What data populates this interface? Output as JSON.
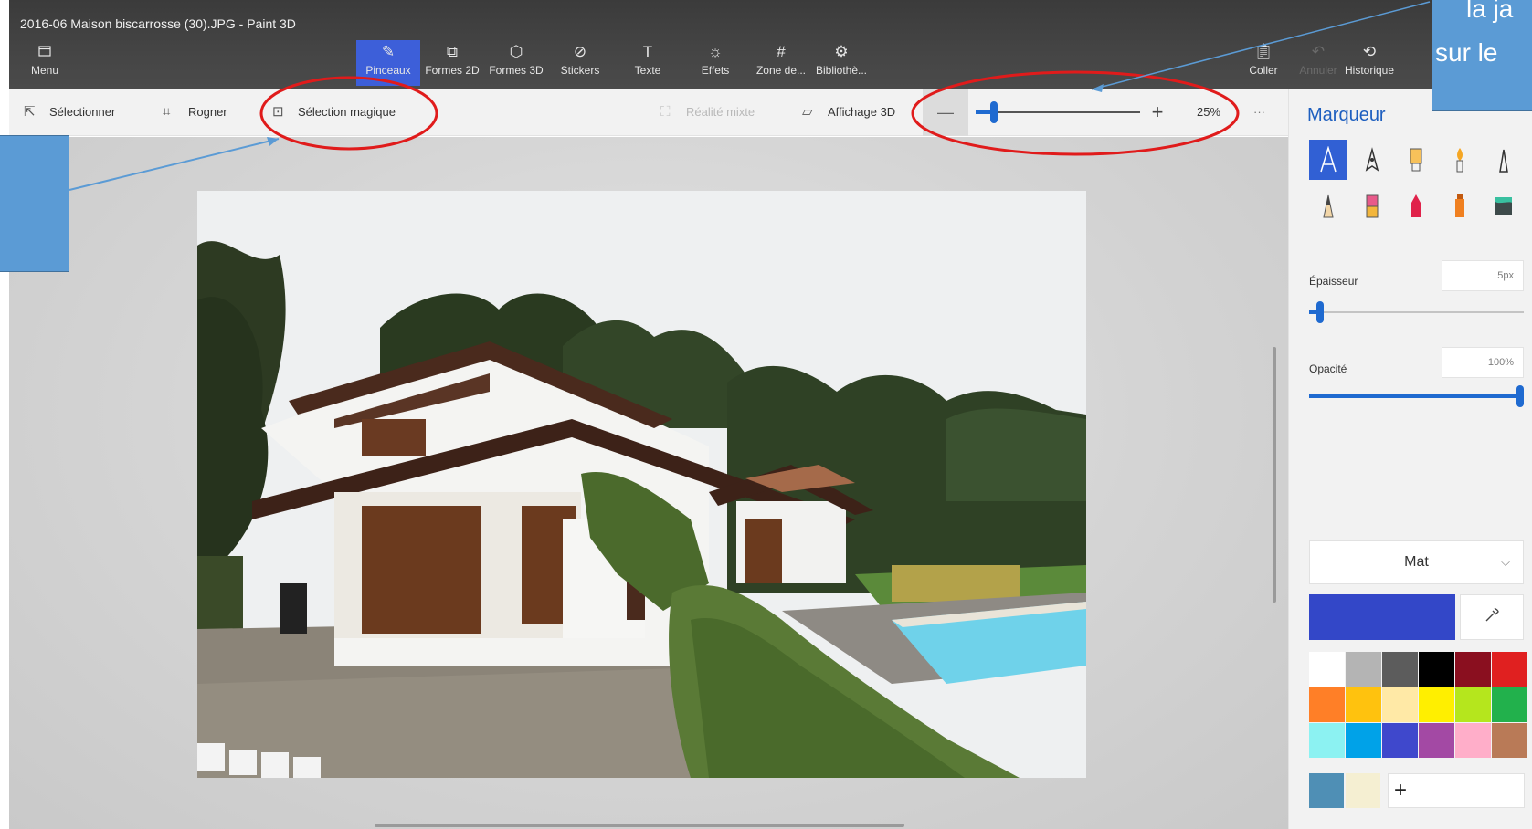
{
  "window": {
    "title": "2016-06 Maison biscarrosse (30).JPG - Paint 3D"
  },
  "menu": {
    "label": "Menu",
    "icon": "folder-icon"
  },
  "toolbar": {
    "tools": [
      {
        "label": "Pinceaux",
        "icon": "brush-icon",
        "active": true
      },
      {
        "label": "Formes 2D",
        "icon": "shapes-2d-icon"
      },
      {
        "label": "Formes 3D",
        "icon": "shapes-3d-icon"
      },
      {
        "label": "Stickers",
        "icon": "sticker-icon"
      },
      {
        "label": "Texte",
        "icon": "text-icon"
      },
      {
        "label": "Effets",
        "icon": "effects-icon"
      },
      {
        "label": "Zone de...",
        "icon": "canvas-icon"
      },
      {
        "label": "Bibliothè...",
        "icon": "library-icon"
      }
    ],
    "right": [
      {
        "label": "Coller",
        "icon": "paste-icon"
      },
      {
        "label": "Annuler",
        "icon": "undo-icon",
        "disabled": true
      },
      {
        "label": "Historique",
        "icon": "history-icon"
      }
    ]
  },
  "toolbar2": {
    "select": "Sélectionner",
    "crop": "Rogner",
    "magic_select": "Sélection magique",
    "mixed_reality": "Réalité mixte",
    "view3d": "Affichage 3D",
    "zoom_out": "—",
    "zoom_in": "+",
    "zoom_value": "25%",
    "zoom_fraction": 0.1,
    "more": "···"
  },
  "panel": {
    "title": "Marqueur",
    "thickness_label": "Épaisseur",
    "thickness_value": "5px",
    "thickness_fraction": 0.05,
    "opacity_label": "Opacité",
    "opacity_value": "100%",
    "opacity_fraction": 1.0,
    "finish": "Mat",
    "finish_chevron": "⌵",
    "eyedropper_icon": "eyedropper-icon",
    "active_color": "#3347c8",
    "palette": [
      "#ffffff",
      "#b4b4b4",
      "#5c5c5c",
      "#000000",
      "#8a0f1f",
      "#e02020",
      "#ff7f27",
      "#ffc20e",
      "#ffe9a6",
      "#ffef00",
      "#b5e61d",
      "#22b14c",
      "#8cf2f2",
      "#00a2e8",
      "#3f48cc",
      "#a349a4",
      "#ffaec9",
      "#b97a57"
    ],
    "custom_colors": [
      "#4f8fb5",
      "#f5efd2"
    ],
    "add_label": "+"
  },
  "annotation": {
    "line1": "la ja",
    "line2": "sur le",
    "callout_color": "#5b9bd5",
    "circle_color": "#e01b1b",
    "arrow_color": "#5b9bd5"
  }
}
